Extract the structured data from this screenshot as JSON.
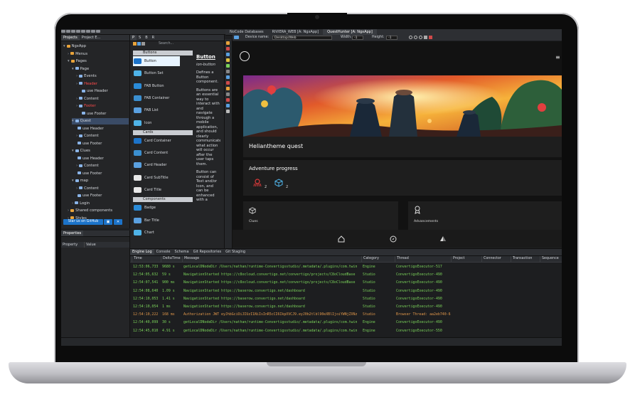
{
  "project_tabs": [
    "Projects",
    "Project E..."
  ],
  "tree": [
    {
      "label": "NgxApp",
      "depth": 0,
      "arrow": "▾",
      "color": "#d6d9de"
    },
    {
      "label": "Menus",
      "depth": 1,
      "arrow": "›",
      "color": "#d6d9de"
    },
    {
      "label": "Pages",
      "depth": 1,
      "arrow": "▾",
      "color": "#d6d9de"
    },
    {
      "label": "Page",
      "depth": 2,
      "arrow": "▾",
      "color": "#d6d9de"
    },
    {
      "label": "Events",
      "depth": 3,
      "arrow": "›",
      "color": "#d6d9de"
    },
    {
      "label": "Header",
      "depth": 3,
      "arrow": "›",
      "color": "#ff4b4b"
    },
    {
      "label": "use Header",
      "depth": 4,
      "arrow": "",
      "color": "#d6d9de"
    },
    {
      "label": "Content",
      "depth": 3,
      "arrow": "›",
      "color": "#d6d9de"
    },
    {
      "label": "Footer",
      "depth": 3,
      "arrow": "›",
      "color": "#ff4b4b"
    },
    {
      "label": "use Footer",
      "depth": 4,
      "arrow": "",
      "color": "#d6d9de"
    },
    {
      "label": "Quest",
      "depth": 2,
      "arrow": "▾",
      "color": "#d6d9de"
    },
    {
      "label": "use Header",
      "depth": 3,
      "arrow": "",
      "color": "#d6d9de"
    },
    {
      "label": "Content",
      "depth": 3,
      "arrow": "›",
      "color": "#d6d9de"
    },
    {
      "label": "use Footer",
      "depth": 3,
      "arrow": "",
      "color": "#d6d9de"
    },
    {
      "label": "Clues",
      "depth": 2,
      "arrow": "▾",
      "color": "#d6d9de"
    },
    {
      "label": "use Header",
      "depth": 3,
      "arrow": "",
      "color": "#d6d9de"
    },
    {
      "label": "Content",
      "depth": 3,
      "arrow": "›",
      "color": "#d6d9de"
    },
    {
      "label": "use Footer",
      "depth": 3,
      "arrow": "",
      "color": "#d6d9de"
    },
    {
      "label": "map",
      "depth": 2,
      "arrow": "▾",
      "color": "#d6d9de"
    },
    {
      "label": "Content",
      "depth": 3,
      "arrow": "›",
      "color": "#d6d9de"
    },
    {
      "label": "use Footer",
      "depth": 3,
      "arrow": "",
      "color": "#d6d9de"
    },
    {
      "label": "Login",
      "depth": 2,
      "arrow": "›",
      "color": "#d6d9de"
    },
    {
      "label": "Shared components",
      "depth": 1,
      "arrow": "›",
      "color": "#d6d9de"
    },
    {
      "label": "Styles",
      "depth": 1,
      "arrow": "›",
      "color": "#d6d9de"
    }
  ],
  "star_button": "Star us on GitHub",
  "properties": {
    "tab": "Properties",
    "col_property": "Property",
    "col_value": "Value"
  },
  "palette": {
    "tabs": [
      "P",
      "S",
      "B",
      "R"
    ],
    "search_placeholder": "Search...",
    "sections": [
      {
        "title": "Buttons",
        "items": [
          "Button",
          "Button Set",
          "FAB Button",
          "FAB Container",
          "FAB List",
          "Icon"
        ]
      },
      {
        "title": "Cards",
        "items": [
          "Card Container",
          "Card Content",
          "Card Header",
          "Card SubTitle",
          "Card Title"
        ]
      },
      {
        "title": "Components",
        "items": [
          "Badge",
          "Bar Title",
          "Chart"
        ]
      }
    ],
    "selected_item": "Button"
  },
  "doc": {
    "title": "Button",
    "p1": "ion-button",
    "p2": "Defines a Button component.",
    "p3": "Buttons are an essential way to interact with and navigate through a mobile application, and should clearly communicate what action will occur after the user taps them.",
    "p4": "Button can consist of Text and/or Icon, and can be enhanced with a"
  },
  "editor_tabs": [
    "NoCode Databases",
    "RIVIERA_WEB [A: NgxApp]",
    "QuestHunter [A: NgxApp]"
  ],
  "device_bar": {
    "label": "Device name:",
    "device": "Desktop/Web",
    "width_label": "Width:",
    "width": "-1",
    "height_label": "Height:",
    "height": "-1"
  },
  "app": {
    "quest_title": "Heliantheme quest",
    "progress_title": "Adventure progress",
    "progress_counts": [
      "2",
      "2"
    ],
    "clues_label": "Clues",
    "adv_label": "Advancements",
    "accent_red": "#e03a3a",
    "accent_blue": "#4fb3e8"
  },
  "console": {
    "tabs": [
      "Engine Log",
      "Console",
      "Schema",
      "Git Repositories",
      "Git Staging"
    ],
    "columns": [
      "Time",
      "DeltaTime",
      "Message",
      "Category",
      "Thread",
      "Project",
      "Connector",
      "Transaction",
      "Sequence"
    ],
    "rows": [
      {
        "time": "12:53:06,733",
        "delta": "9680 s",
        "msg": "getLocalDNodeDir /Users/nathan/runtime-Convertigsstudio/.metadata/.plugins/com.twin",
        "cat": "Engine",
        "thread": "ConvertigoExecutor-517",
        "color": "#7bd35a"
      },
      {
        "time": "12:54:05,632",
        "delta": "59 s",
        "msg": "NavigationStarted https://c8ocloud.convertigo.net/convertigo/projects/C8oCloudBase",
        "cat": "Studio",
        "thread": "ConvertigoExecutor-490",
        "color": "#7bd35a"
      },
      {
        "time": "12:54:07,541",
        "delta": "900 ms",
        "msg": "NavigationStarted https://c8ocloud.convertigo.net/convertigo/projects/C8oCloudBase",
        "cat": "Studio",
        "thread": "ConvertigoExecutor-490",
        "color": "#7bd35a"
      },
      {
        "time": "12:54:08,640",
        "delta": "1.09 s",
        "msg": "NavigationStarted https://baserow.convertigo.net/dashboard",
        "cat": "Studio",
        "thread": "ConvertigoExecutor-490",
        "color": "#7bd35a"
      },
      {
        "time": "12:54:10,053",
        "delta": "1.41 s",
        "msg": "NavigationStarted https://baserow.convertigo.net/dashboard",
        "cat": "Studio",
        "thread": "ConvertigoExecutor-490",
        "color": "#7bd35a"
      },
      {
        "time": "12:54:10,054",
        "delta": "1 ms",
        "msg": "NavigationStarted https://baserow.convertigo.net/dashboard",
        "cat": "Studio",
        "thread": "ConvertigoExecutor-490",
        "color": "#7bd35a"
      },
      {
        "time": "12:54:10,222",
        "delta": "168 ms",
        "msg": "Authorization JWT eyJhbGciOiJIUzI1NiIsInR5cCI6IkpXVCJ9.eyJ0b2tlbl90eXBlIjoiYWNjZXNz",
        "cat": "Studio",
        "thread": "Browser Thread: aa2eb740-6",
        "color": "#e0974a"
      },
      {
        "time": "12:54:40,099",
        "delta": "30 s",
        "msg": "getLocalDNodeDir /Users/nathan/runtime-Convertigsstudio/.metadata/.plugins/com.twin",
        "cat": "Engine",
        "thread": "ConvertigoExecutor-490",
        "color": "#7bd35a"
      },
      {
        "time": "12:54:45,010",
        "delta": "4.91 s",
        "msg": "getLocalDNodeDir /Users/nathan/runtime-Convertigsstudio/.metadata/.plugins/com.twin",
        "cat": "Engine",
        "thread": "ConvertigoExecutor-550",
        "color": "#7bd35a"
      }
    ]
  }
}
